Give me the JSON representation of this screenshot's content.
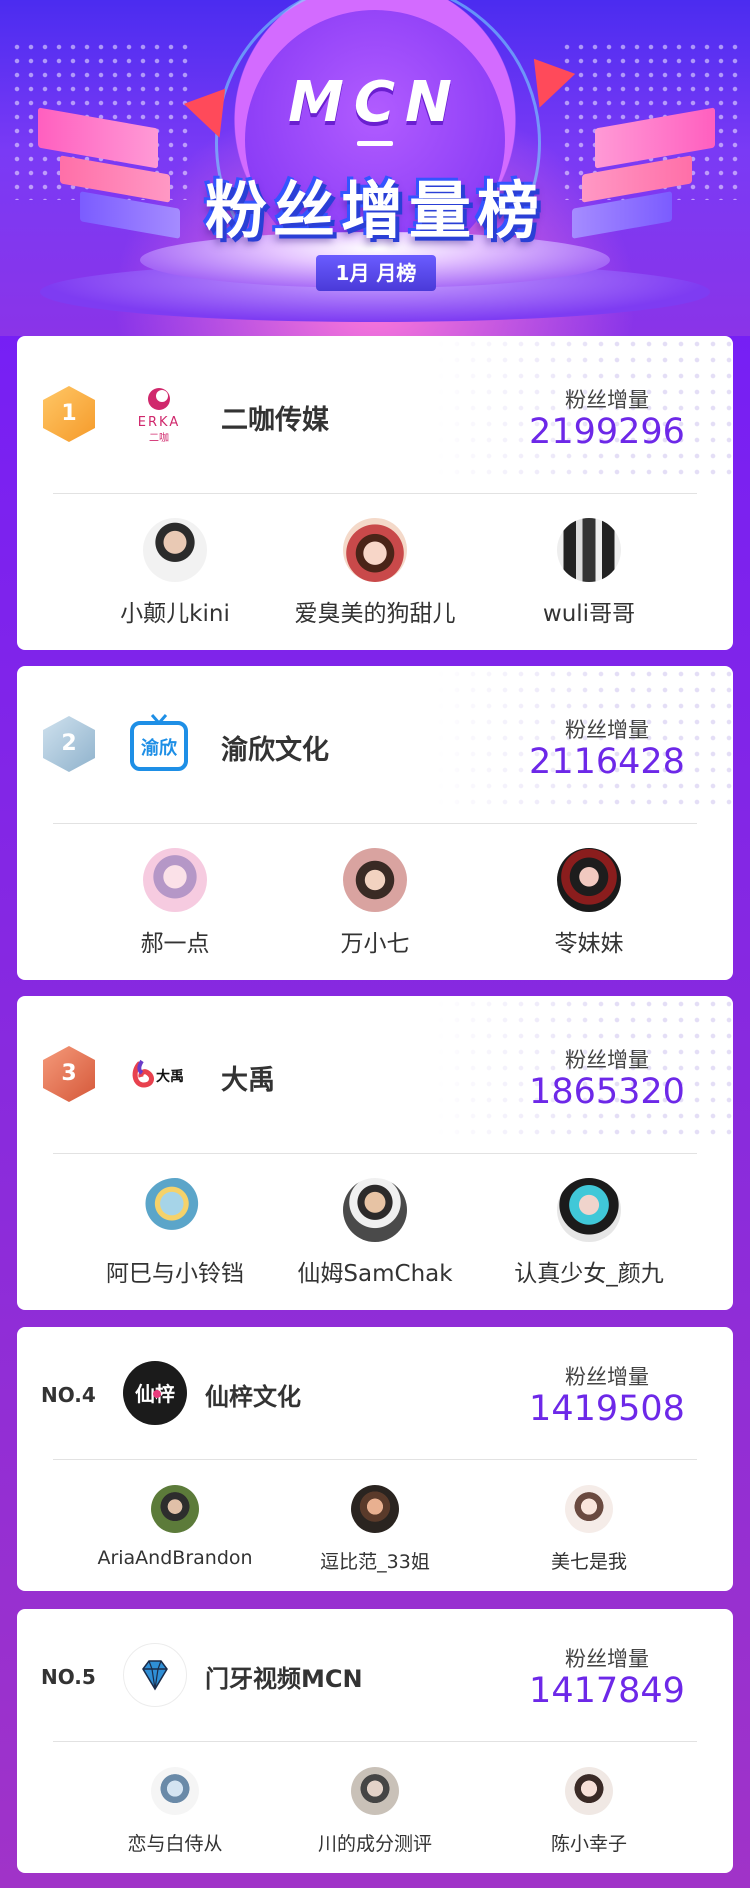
{
  "header": {
    "brand": "MCN",
    "title": "粉丝增量榜",
    "period": "1月 月榜"
  },
  "colors": {
    "accent_number": "#6d28e8",
    "background_top": "#6a1bff",
    "background_bottom": "#a033c8",
    "rank1": "#f5a033",
    "rank2": "#9fbdd4",
    "rank3": "#e06a4c"
  },
  "fan_label": "粉丝增量",
  "entries": [
    {
      "rank_badge": "1",
      "name": "二咖传媒",
      "logo_icon": "erka-logo-icon",
      "logo_text": "ERKA",
      "logo_subtext": "二咖",
      "fans": "2199296",
      "members": [
        "小颠儿kini",
        "爱臭美的狗甜儿",
        "wuli哥哥"
      ]
    },
    {
      "rank_badge": "2",
      "name": "渝欣文化",
      "logo_icon": "tv-logo-icon",
      "logo_text": "渝欣",
      "fans": "2116428",
      "members": [
        "郝一点",
        "万小七",
        "苓妹妹"
      ]
    },
    {
      "rank_badge": "3",
      "name": "大禹",
      "logo_icon": "dayu-logo-icon",
      "logo_text": "大禹",
      "fans": "1865320",
      "members": [
        "阿巳与小铃铛",
        "仙姆SamChak",
        "认真少女_颜九"
      ]
    },
    {
      "rank_badge": "NO.4",
      "name": "仙梓文化",
      "logo_icon": "xianzi-logo-icon",
      "logo_text": "仙梓",
      "fans": "1419508",
      "members": [
        "AriaAndBrandon",
        "逗比范_33姐",
        "美七是我"
      ]
    },
    {
      "rank_badge": "NO.5",
      "name": "门牙视频MCN",
      "logo_icon": "diamond-logo-icon",
      "fans": "1417849",
      "members": [
        "恋与白侍从",
        "川的成分测评",
        "陈小幸子"
      ]
    }
  ]
}
